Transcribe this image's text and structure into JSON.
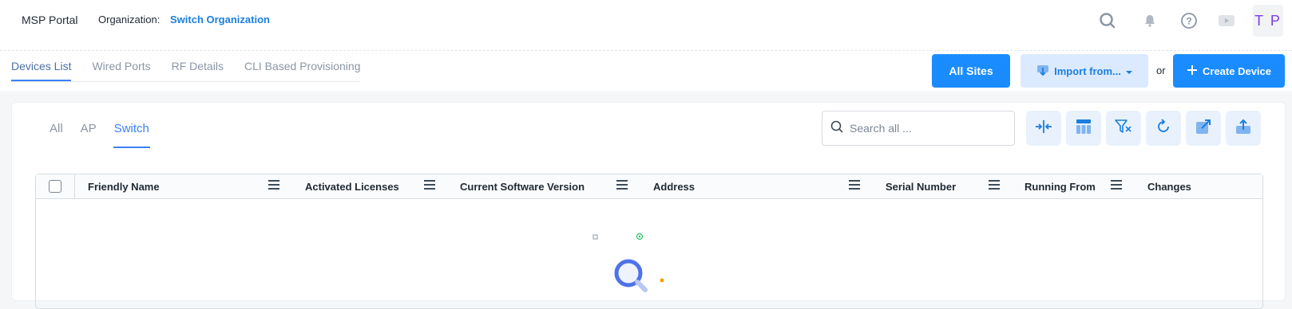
{
  "header": {
    "brand": "MSP Portal",
    "org_label": "Organization:",
    "org_name": "Switch Organization",
    "icons": [
      "search-icon",
      "bell-icon",
      "help-icon",
      "video-icon"
    ],
    "avatar_initials": "T P"
  },
  "nav_tabs": [
    {
      "label": "Devices List",
      "active": true
    },
    {
      "label": "Wired Ports",
      "active": false
    },
    {
      "label": "RF Details",
      "active": false
    },
    {
      "label": "CLI Based Provisioning",
      "active": false
    }
  ],
  "actions": {
    "all_sites": "All Sites",
    "import": "Import from...",
    "or": "or",
    "create_device": "Create Device"
  },
  "filter_tabs": [
    {
      "label": "All",
      "active": false
    },
    {
      "label": "AP",
      "active": false
    },
    {
      "label": "Switch",
      "active": true
    }
  ],
  "search": {
    "placeholder": "Search all ...",
    "value": ""
  },
  "toolbar_icons": [
    "collapse-columns-icon",
    "column-layout-icon",
    "clear-filter-icon",
    "refresh-icon",
    "open-external-icon",
    "export-icon"
  ],
  "table": {
    "columns": [
      "Friendly Name",
      "Activated Licenses",
      "Current Software Version",
      "Address",
      "Serial Number",
      "Running From",
      "Changes"
    ]
  },
  "colors": {
    "primary": "#1a8cff",
    "link": "#1a7fe0",
    "avatar_text": "#7b3fe4",
    "tool_bg": "#e8f1fc"
  }
}
